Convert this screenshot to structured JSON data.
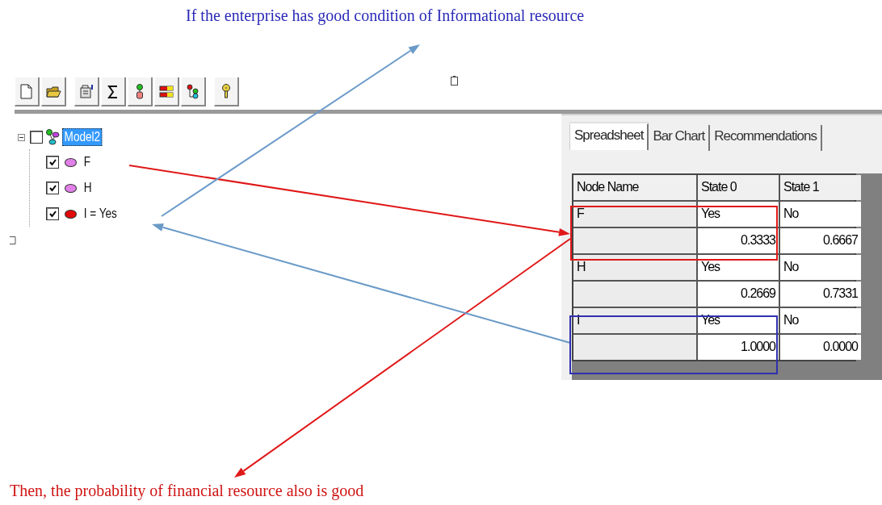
{
  "annotations": {
    "captions": [
      {
        "text": "If the enterprise has good condition of Informational resource",
        "color": "#2a2ab8"
      },
      {
        "text": "Then, the probability of financial resource also is good",
        "color": "#d01414"
      }
    ],
    "arrows": [
      {
        "color": "#e01818"
      },
      {
        "color": "#e01818"
      },
      {
        "color": "#6a9ac8"
      },
      {
        "color": "#6a9ac8"
      }
    ],
    "boxes": [
      {
        "color": "#e01818"
      },
      {
        "color": "#3030b0"
      }
    ]
  },
  "tree": {
    "label": "Model2",
    "selected": true,
    "checked": false,
    "expanded": true,
    "children": [
      {
        "label": "F",
        "checked": true,
        "color": "#e080e8"
      },
      {
        "label": "H",
        "checked": true,
        "color": "#e080e8"
      },
      {
        "label": "I = Yes",
        "checked": true,
        "color": "#e00a0a"
      }
    ]
  },
  "tabs": [
    {
      "label": "Spreadsheet",
      "selected": true
    },
    {
      "label": "Bar Chart",
      "selected": false
    },
    {
      "label": "Recommendations",
      "selected": false
    }
  ],
  "table": {
    "columns": [
      "Node Name",
      "State 0",
      "State 1"
    ],
    "rows": [
      {
        "node": "F",
        "states": [
          "Yes",
          "No"
        ],
        "values": [
          "0.3333",
          "0.6667"
        ]
      },
      {
        "node": "H",
        "states": [
          "Yes",
          "No"
        ],
        "values": [
          "0.2669",
          "0.7331"
        ]
      },
      {
        "node": "I",
        "states": [
          "Yes",
          "No"
        ],
        "values": [
          "1.0000",
          "0.0000"
        ]
      }
    ]
  }
}
